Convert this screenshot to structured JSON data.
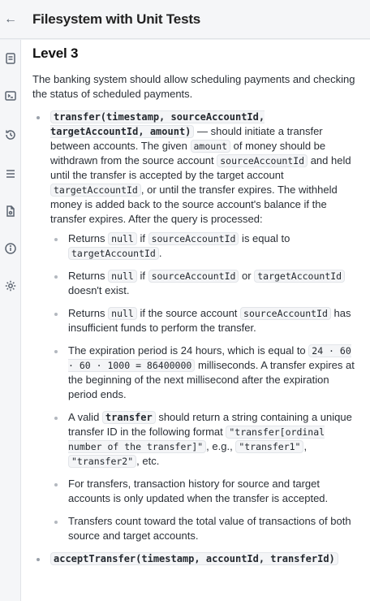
{
  "header": {
    "title": "Filesystem with Unit Tests"
  },
  "sidebar": {
    "icons": [
      "note-icon",
      "terminal-icon",
      "history-icon",
      "menu-icon",
      "document-icon",
      "info-icon",
      "settings-icon"
    ]
  },
  "main": {
    "level_title": "Level 3",
    "intro": "The banking system should allow scheduling payments and checking the status of scheduled payments.",
    "transfer": {
      "signature": "transfer(timestamp, sourceAccountId, targetAccountId, amount)",
      "t1": " — should initiate a transfer between accounts. The given ",
      "c1": "amount",
      "t2": " of money should be withdrawn from the source account ",
      "c2": "sourceAccountId",
      "t3": " and held until the transfer is accepted by the target account ",
      "c3": "targetAccountId",
      "t4": ", or until the transfer expires. The withheld money is added back to the source account's balance if the transfer expires. After the query is processed:"
    },
    "sub": {
      "s1": {
        "a": "Returns ",
        "c1": "null",
        "b": " if ",
        "c2": "sourceAccountId",
        "c": " is equal to ",
        "c3": "targetAccountId",
        "d": "."
      },
      "s2": {
        "a": "Returns ",
        "c1": "null",
        "b": " if ",
        "c2": "sourceAccountId",
        "c": " or ",
        "c3": "targetAccountId",
        "d": " doesn't exist."
      },
      "s3": {
        "a": "Returns ",
        "c1": "null",
        "b": " if the source account ",
        "c2": "sourceAccountId",
        "c": " has insufficient funds to perform the transfer."
      },
      "s4": {
        "a": "The expiration period is 24 hours, which is equal to ",
        "c1": "24 · 60 · 60 · 1000 = 86400000",
        "b": " milliseconds. A transfer expires at the beginning of the next millisecond after the expiration period ends."
      },
      "s5": {
        "a": "A valid ",
        "c1": "transfer",
        "b": " should return a string containing a unique transfer ID in the following format ",
        "c2": "\"transfer[ordinal number of the transfer]\"",
        "c": ", e.g., ",
        "c3": "\"transfer1\"",
        "d": ", ",
        "c4": "\"transfer2\"",
        "e": ", etc."
      },
      "s6": {
        "a": "For transfers, transaction history for source and target accounts is only updated when the transfer is accepted."
      },
      "s7": {
        "a": "Transfers count toward the total value of transactions of both source and target accounts."
      }
    },
    "accept": {
      "signature": "acceptTransfer(timestamp, accountId, transferId)"
    }
  }
}
